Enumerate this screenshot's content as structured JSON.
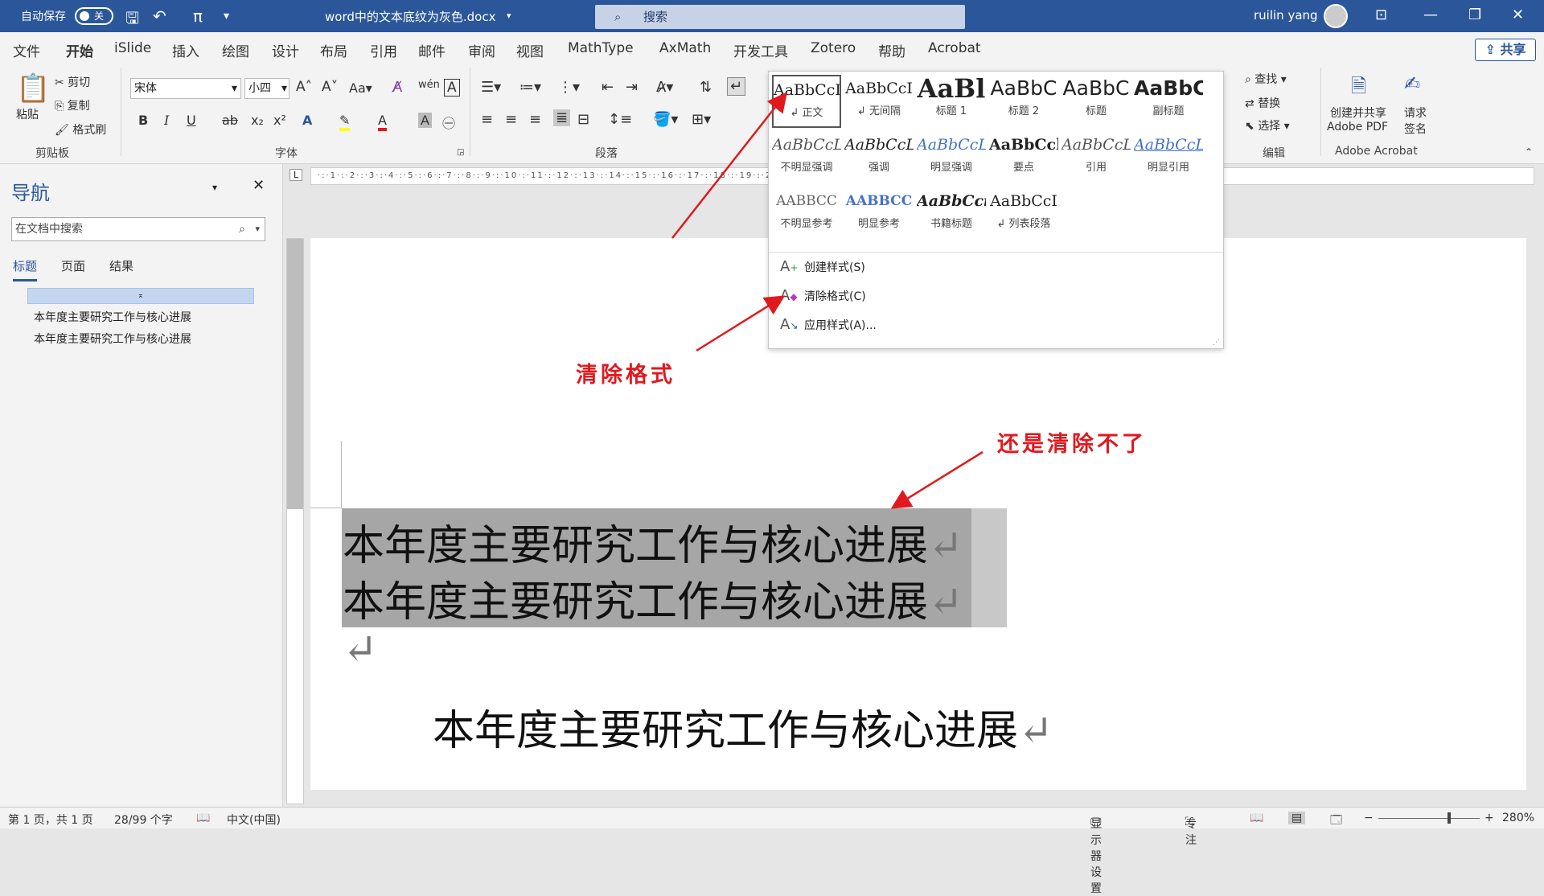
{
  "titlebar": {
    "autosave_label": "自动保存",
    "autosave_state": "关",
    "doc_title": "word中的文本底纹为灰色.docx",
    "search_label": "搜索",
    "user_name": "ruilin yang"
  },
  "menu": {
    "items": [
      "文件",
      "开始",
      "iSlide",
      "插入",
      "绘图",
      "设计",
      "布局",
      "引用",
      "邮件",
      "审阅",
      "视图",
      "MathType",
      "AxMath",
      "开发工具",
      "Zotero",
      "帮助",
      "Acrobat"
    ],
    "share": "共享"
  },
  "clipboard": {
    "paste": "粘贴",
    "cut": "剪切",
    "copy": "复制",
    "format_painter": "格式刷",
    "group": "剪贴板"
  },
  "font": {
    "name": "宋体",
    "size": "小四",
    "group": "字体",
    "bold": "B",
    "italic": "I",
    "underline": "U",
    "strike": "ab",
    "sub": "x₂",
    "sup": "x²",
    "case": "Aa"
  },
  "paragraph": {
    "group": "段落"
  },
  "editing": {
    "find": "查找",
    "replace": "替换",
    "select": "选择",
    "group": "编辑"
  },
  "acrobat": {
    "create_share": "创建并共享",
    "adobe_pdf": "Adobe PDF",
    "request": "请求",
    "sign": "签名",
    "group": "Adobe Acrobat"
  },
  "styles": [
    {
      "sample": "AaBbCcI",
      "name": "↲ 正文"
    },
    {
      "sample": "AaBbCcI",
      "name": "↲ 无间隔"
    },
    {
      "sample": "AaBl",
      "name": "标题 1"
    },
    {
      "sample": "AaBbC",
      "name": "标题 2"
    },
    {
      "sample": "AaBbC",
      "name": "标题"
    },
    {
      "sample": "AaBbC",
      "name": "副标题"
    },
    {
      "sample": "AaBbCcL",
      "name": "不明显强调"
    },
    {
      "sample": "AaBbCcL",
      "name": "强调"
    },
    {
      "sample": "AaBbCcL",
      "name": "明显强调"
    },
    {
      "sample": "AaBbCcl",
      "name": "要点"
    },
    {
      "sample": "AaBbCcL",
      "name": "引用"
    },
    {
      "sample": "AaBbCcL",
      "name": "明显引用"
    },
    {
      "sample": "AABBCC",
      "name": "不明显参考"
    },
    {
      "sample": "AABBCC",
      "name": "明显参考"
    },
    {
      "sample": "AaBbCci",
      "name": "书籍标题"
    },
    {
      "sample": "AaBbCcI",
      "name": "↲ 列表段落"
    }
  ],
  "style_menu": {
    "create": "创建样式(S)",
    "clear": "清除格式(C)",
    "apply": "应用样式(A)..."
  },
  "nav": {
    "title": "导航",
    "search_placeholder": "在文档中搜索",
    "tabs": [
      "标题",
      "页面",
      "结果"
    ],
    "headings": [
      "本年度主要研究工作与核心进展",
      "本年度主要研究工作与核心进展"
    ]
  },
  "document": {
    "lines": [
      "本年度主要研究工作与核心进展",
      "本年度主要研究工作与核心进展",
      "本年度主要研究工作与核心进展"
    ]
  },
  "annotations": {
    "clear_format": "清除格式",
    "still_cannot": "还是清除不了"
  },
  "statusbar": {
    "page": "第 1 页，共 1 页",
    "words": "28/99 个字",
    "lang": "中文(中国)",
    "display": "显示器设置",
    "focus": "专注",
    "zoom": "280%"
  },
  "colors": {
    "accent": "#2b579a",
    "annotation": "#e0191f",
    "shading": "#a6a6a6"
  }
}
